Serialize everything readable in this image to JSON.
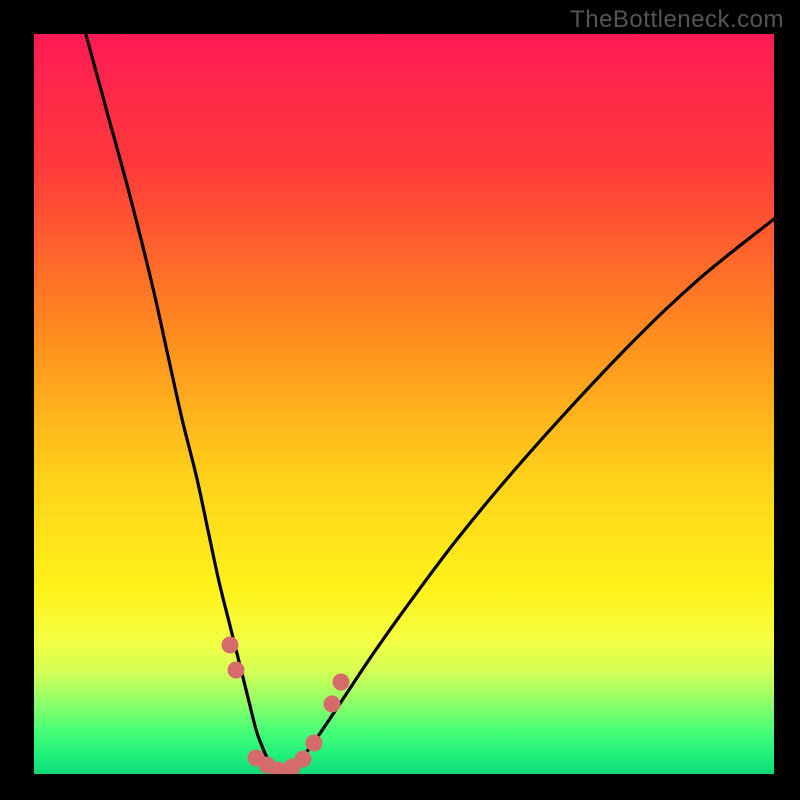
{
  "watermark": "TheBottleneck.com",
  "colors": {
    "bg": "#000000",
    "gradient_stops": [
      {
        "pos": 0.0,
        "color": "#ff1a55"
      },
      {
        "pos": 0.18,
        "color": "#ff3a3a"
      },
      {
        "pos": 0.4,
        "color": "#ff8a1f"
      },
      {
        "pos": 0.6,
        "color": "#ffd21a"
      },
      {
        "pos": 0.75,
        "color": "#fff21a"
      },
      {
        "pos": 0.82,
        "color": "#f4ff43"
      },
      {
        "pos": 0.86,
        "color": "#d6ff55"
      },
      {
        "pos": 0.9,
        "color": "#94ff66"
      },
      {
        "pos": 0.94,
        "color": "#4bff78"
      },
      {
        "pos": 0.98,
        "color": "#18ee7a"
      },
      {
        "pos": 1.0,
        "color": "#0fd877"
      }
    ],
    "curve": "#000000",
    "marker": "#d66b6b",
    "watermark": "#555555"
  },
  "chart_data": {
    "type": "line",
    "title": "",
    "xlabel": "",
    "ylabel": "",
    "xlim": [
      0,
      100
    ],
    "ylim": [
      0,
      100
    ],
    "series": [
      {
        "name": "left-branch",
        "x": [
          7,
          10,
          13,
          16,
          18,
          20,
          22,
          23.5,
          25,
          26.5,
          28,
          29,
          30,
          30.8,
          31.5,
          32.2,
          33
        ],
        "y": [
          100,
          89,
          78,
          66,
          57,
          48,
          40,
          33,
          26,
          20,
          14,
          10,
          6,
          3.8,
          2.2,
          1.0,
          0.2
        ]
      },
      {
        "name": "right-branch",
        "x": [
          33,
          34,
          35.5,
          37,
          39,
          42,
          46,
          51,
          57,
          64,
          72,
          81,
          90,
          100
        ],
        "y": [
          0.2,
          0.6,
          1.6,
          3.2,
          6.0,
          10.5,
          16.5,
          23.5,
          31.5,
          40.0,
          49.0,
          58.5,
          67.0,
          75.0
        ]
      }
    ],
    "markers": [
      {
        "x": 26.5,
        "y": 17.5
      },
      {
        "x": 27.3,
        "y": 14.0
      },
      {
        "x": 30.0,
        "y": 2.2
      },
      {
        "x": 31.5,
        "y": 1.2
      },
      {
        "x": 33.0,
        "y": 0.5
      },
      {
        "x": 34.8,
        "y": 0.9
      },
      {
        "x": 36.3,
        "y": 2.0
      },
      {
        "x": 37.8,
        "y": 4.2
      },
      {
        "x": 40.3,
        "y": 9.5
      },
      {
        "x": 41.5,
        "y": 12.5
      }
    ]
  }
}
